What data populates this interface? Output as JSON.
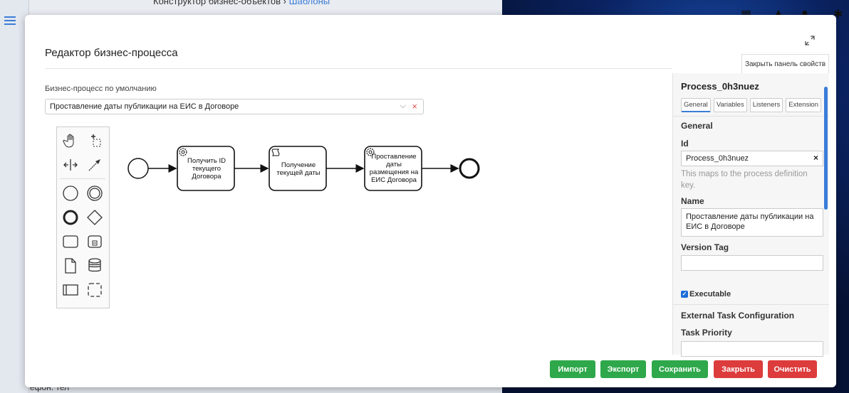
{
  "background": {
    "breadcrumb": {
      "app": "Конструктор бизнес-объектов",
      "sep": "›",
      "link": "Шаблоны"
    },
    "bottom_text": "Телефон: тел"
  },
  "modal": {
    "title": "Редактор бизнес-процесса",
    "close_panel_label": "Закрыть панель свойств",
    "default_process_label": "Бизнес-процесс по умолчанию",
    "default_process_value": "Проставление даты публикации на ЕИС в Договоре"
  },
  "palette": {
    "items": [
      "hand-tool",
      "lasso-tool",
      "space-tool",
      "connect-tool",
      "start-event",
      "intermediate-event",
      "end-event",
      "gateway",
      "task",
      "subprocess",
      "data-object",
      "data-store",
      "pool",
      "group"
    ]
  },
  "diagram": {
    "tasks": [
      {
        "label": "Получить ID текущего Договора",
        "type": "service"
      },
      {
        "label": "Получение текущей даты",
        "type": "script"
      },
      {
        "label": "Проставление даты размещения на ЕИС Договора",
        "type": "service"
      }
    ]
  },
  "properties": {
    "process_id": "Process_0h3nuez",
    "tabs": [
      "General",
      "Variables",
      "Listeners",
      "Extension"
    ],
    "active_tab": "General",
    "section_general": "General",
    "id_label": "Id",
    "id_value": "Process_0h3nuez",
    "id_hint": "This maps to the process definition key.",
    "name_label": "Name",
    "name_value": "Проставление даты публикации на ЕИС в Договоре",
    "version_tag_label": "Version Tag",
    "version_tag_value": "",
    "executable_label": "Executable",
    "executable_checked": true,
    "external_task_section": "External Task Configuration",
    "task_priority_label": "Task Priority",
    "task_priority_value": ""
  },
  "footer": {
    "import": "Импорт",
    "export": "Экспорт",
    "save": "Сохранить",
    "close": "Закрыть",
    "clear": "Очистить"
  },
  "colors": {
    "green": "#2ea84a",
    "red": "#dd3c3c",
    "accent": "#3b7dd8"
  }
}
